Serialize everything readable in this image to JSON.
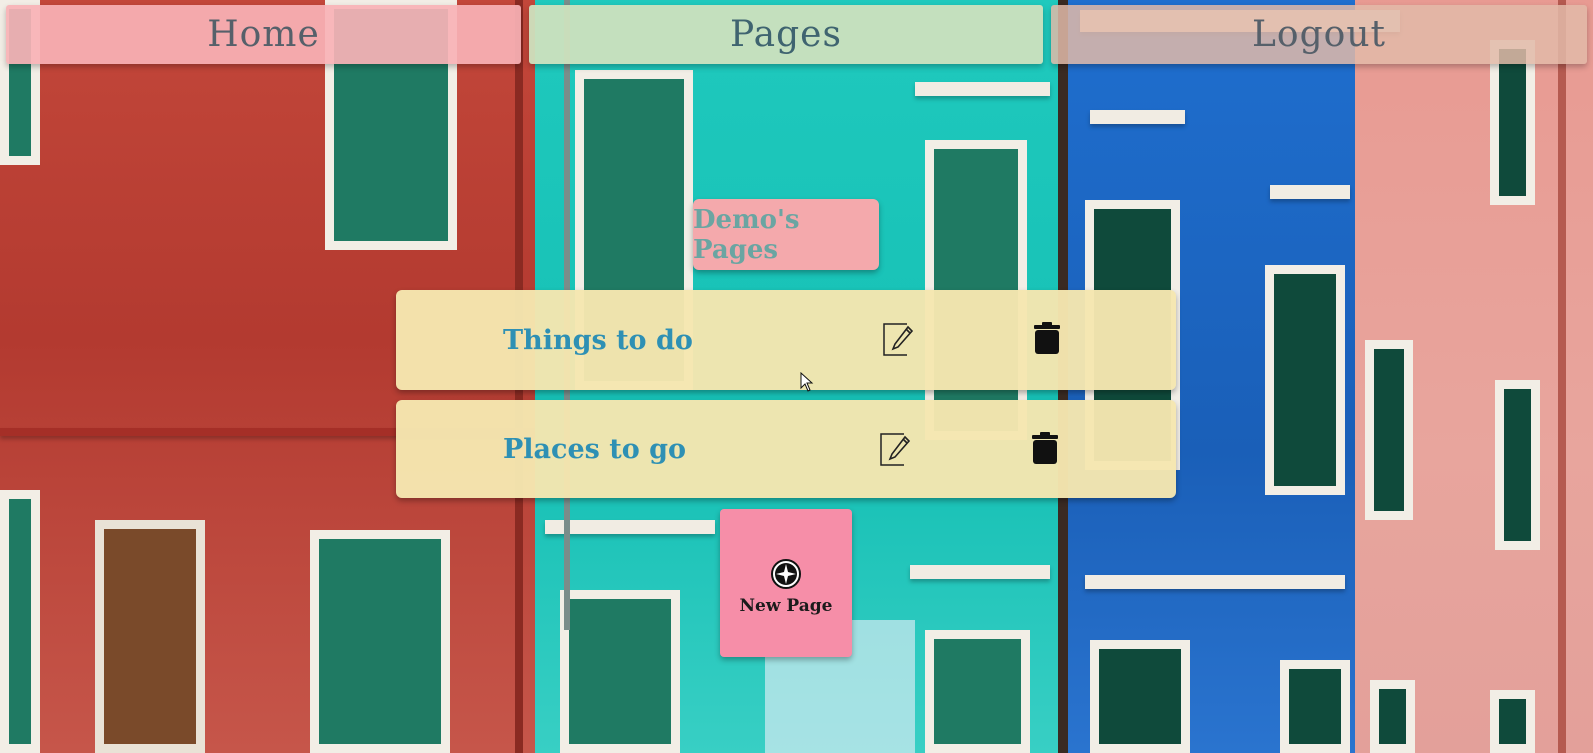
{
  "nav": {
    "home_label": "Home",
    "pages_label": "Pages",
    "logout_label": "Logout",
    "active": "Pages"
  },
  "heading": "Demo's Pages",
  "pages": [
    {
      "title": "Things to do",
      "edit_icon": "edit-icon",
      "delete_icon": "trash-icon"
    },
    {
      "title": "Places to go",
      "edit_icon": "edit-icon",
      "delete_icon": "trash-icon"
    }
  ],
  "new_page": {
    "label": "New Page",
    "icon": "plus-circle-icon"
  },
  "colors": {
    "nav_home_bg": "#f8b2b6",
    "nav_pages_bg": "#cde2be",
    "nav_logout_bg": "#e2baa8",
    "heading_bg": "#f4a9ac",
    "heading_text": "#6aa5a2",
    "row_bg": "#f5e6b0",
    "row_title_text": "#2e90b4",
    "new_page_bg": "#f68ea8"
  }
}
